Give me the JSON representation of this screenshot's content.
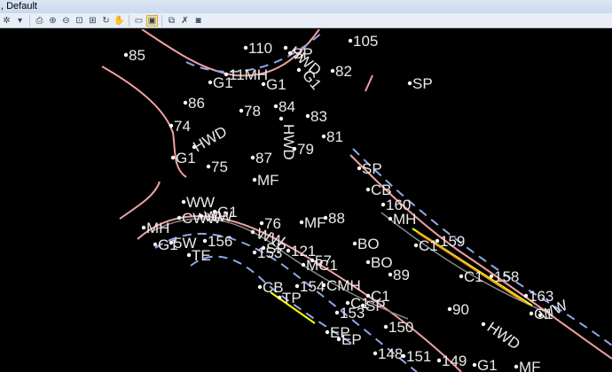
{
  "window": {
    "title": ", Default"
  },
  "toolbar": {
    "buttons": [
      {
        "icon": "settings-gear-icon"
      },
      {
        "icon": "dropdown-arrow-icon"
      },
      {
        "icon": "print-icon"
      },
      {
        "icon": "zoom-in-icon"
      },
      {
        "icon": "zoom-out-icon"
      },
      {
        "icon": "zoom-window-icon"
      },
      {
        "icon": "zoom-extents-icon"
      },
      {
        "icon": "rotate-view-icon"
      },
      {
        "icon": "pan-hand-icon"
      },
      {
        "icon": "view-previous-icon"
      },
      {
        "icon": "view-active-icon",
        "active": true
      },
      {
        "icon": "copy-view-icon"
      },
      {
        "icon": "select-tool-icon"
      },
      {
        "icon": "camera-icon"
      }
    ]
  },
  "colors": {
    "background": "#000000",
    "road_edge": "#f0a0a0",
    "dashed_line": "#8fa8e8",
    "highlight": "#ffff00",
    "orange": "#f0a020",
    "points": "#ffffff",
    "text": "#eaeaea"
  },
  "labels": [
    "85",
    "110",
    "SP",
    "105",
    "11MH",
    "G1",
    "G1",
    "82",
    "86",
    "78",
    "84",
    "83",
    "74",
    "81",
    "79",
    "G1",
    "75",
    "87",
    "MF",
    "SP",
    "CB",
    "160",
    "MH",
    "159",
    "C1",
    "MF",
    "88",
    "76",
    "WW",
    "156",
    "TE",
    "153",
    "121",
    "BO",
    "MC1",
    "BO",
    "89",
    "C1",
    "158",
    "163",
    "CB",
    "154",
    "CMH",
    "TP",
    "C1",
    "153",
    "SP",
    "150",
    "90",
    "EP",
    "EP",
    "148",
    "151",
    "149",
    "G1",
    "MF",
    "HWD",
    "WW",
    "WW",
    "G1",
    "HWD",
    "SP",
    "G1",
    "HWD",
    "HWD",
    "C1",
    "MH",
    "CWW",
    "WW",
    "G1",
    "5W",
    "57",
    "C1",
    "SP"
  ]
}
